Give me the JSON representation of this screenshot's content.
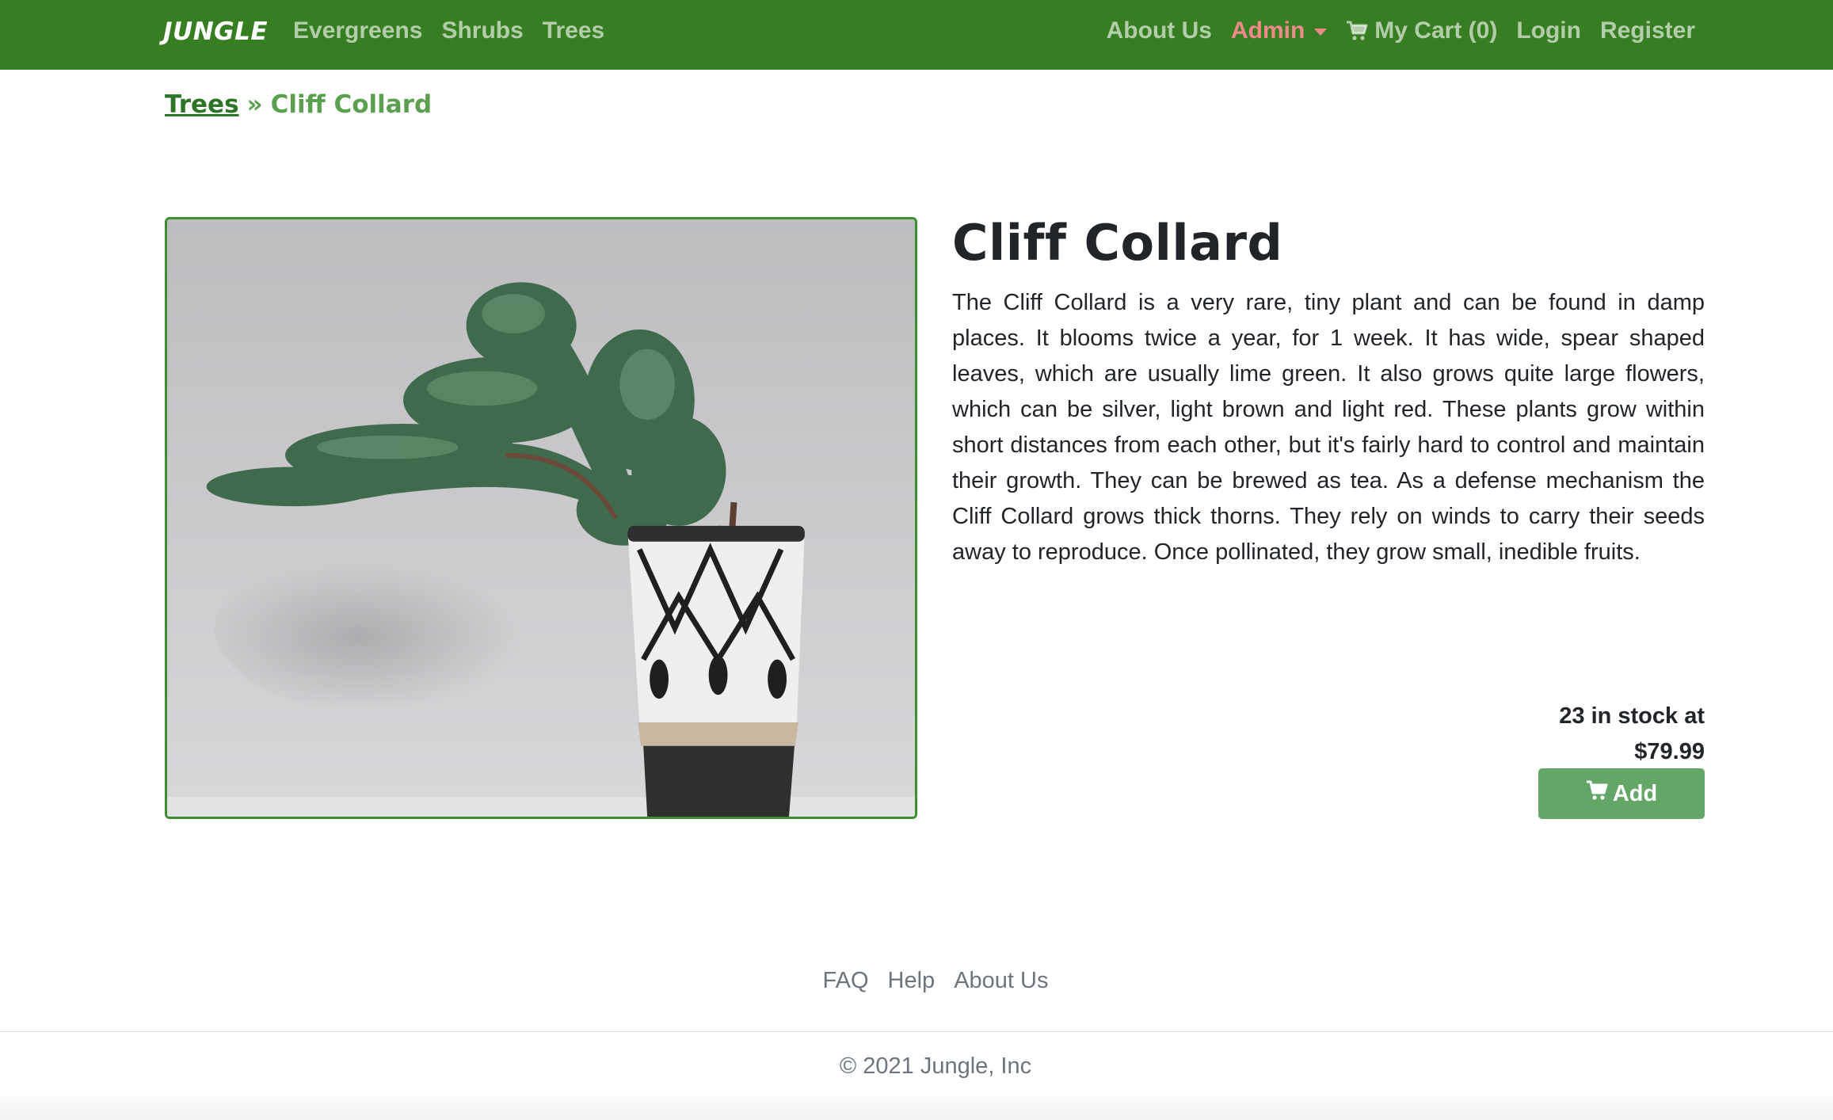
{
  "navbar": {
    "brand": "JUNGLE",
    "left_links": [
      "Evergreens",
      "Shrubs",
      "Trees"
    ],
    "about": "About Us",
    "admin": "Admin",
    "cart": "My Cart (0)",
    "login": "Login",
    "register": "Register",
    "colors": {
      "background": "#377d22",
      "admin": "#ef8a8a"
    }
  },
  "breadcrumb": {
    "parent": "Trees",
    "separator": "»",
    "current": "Cliff Collard"
  },
  "product": {
    "name": "Cliff Collard",
    "description": "The Cliff Collard is a very rare, tiny plant and can be found in damp places. It blooms twice a year, for 1 week. It has wide, spear shaped leaves, which are usually lime green. It also grows quite large flowers, which can be silver, light brown and light red. These plants grow within short distances from each other, but it's fairly hard to control and maintain their growth. They can be brewed as tea. As a defense mechanism the Cliff Collard grows thick thorns. They rely on winds to carry their seeds away to reproduce. Once pollinated, they grow small, inedible fruits.",
    "stock_line": "23 in stock at",
    "price": "$79.99",
    "add_label": "Add",
    "colors": {
      "add_button": "#63a667",
      "image_border": "#3c8f31"
    }
  },
  "footer": {
    "links": [
      "FAQ",
      "Help",
      "About Us"
    ],
    "copyright": "© 2021 Jungle, Inc"
  },
  "icons": {
    "cart": "cart-icon",
    "caret": "chevron-down-icon"
  }
}
